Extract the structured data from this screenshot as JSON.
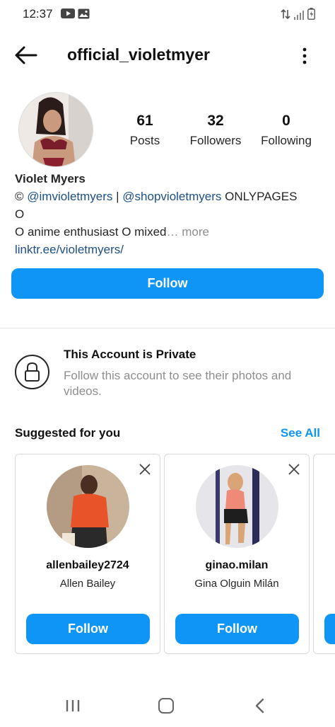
{
  "status_bar": {
    "time": "12:37"
  },
  "header": {
    "username": "official_violetmyer"
  },
  "profile": {
    "stats": [
      {
        "value": "61",
        "label": "Posts"
      },
      {
        "value": "32",
        "label": "Followers"
      },
      {
        "value": "0",
        "label": "Following"
      }
    ],
    "name": "Violet Myers",
    "bio_prefix": "© ",
    "mention_1": "@imvioletmyers",
    "separator": " | ",
    "mention_2": "@shopvioletmyers",
    "bio_suffix": " ONLYPAGES",
    "bio_line2": "O",
    "bio_line3": "O anime enthusiast O mixed",
    "more_label": "… more",
    "link": "linktr.ee/violetmyers/",
    "follow_label": "Follow"
  },
  "private": {
    "title": "This Account is Private",
    "description": "Follow this account to see their photos and videos."
  },
  "suggested": {
    "title": "Suggested for you",
    "see_all": "See All",
    "cards": [
      {
        "username": "allenbailey2724",
        "full_name": "Allen Bailey",
        "follow_label": "Follow"
      },
      {
        "username": "ginao.milan",
        "full_name": "Gina Olguin Milán",
        "follow_label": "Follow"
      }
    ]
  },
  "colors": {
    "accent": "#0f95f6",
    "link": "#1c4f86",
    "muted": "#8e8e8e"
  }
}
